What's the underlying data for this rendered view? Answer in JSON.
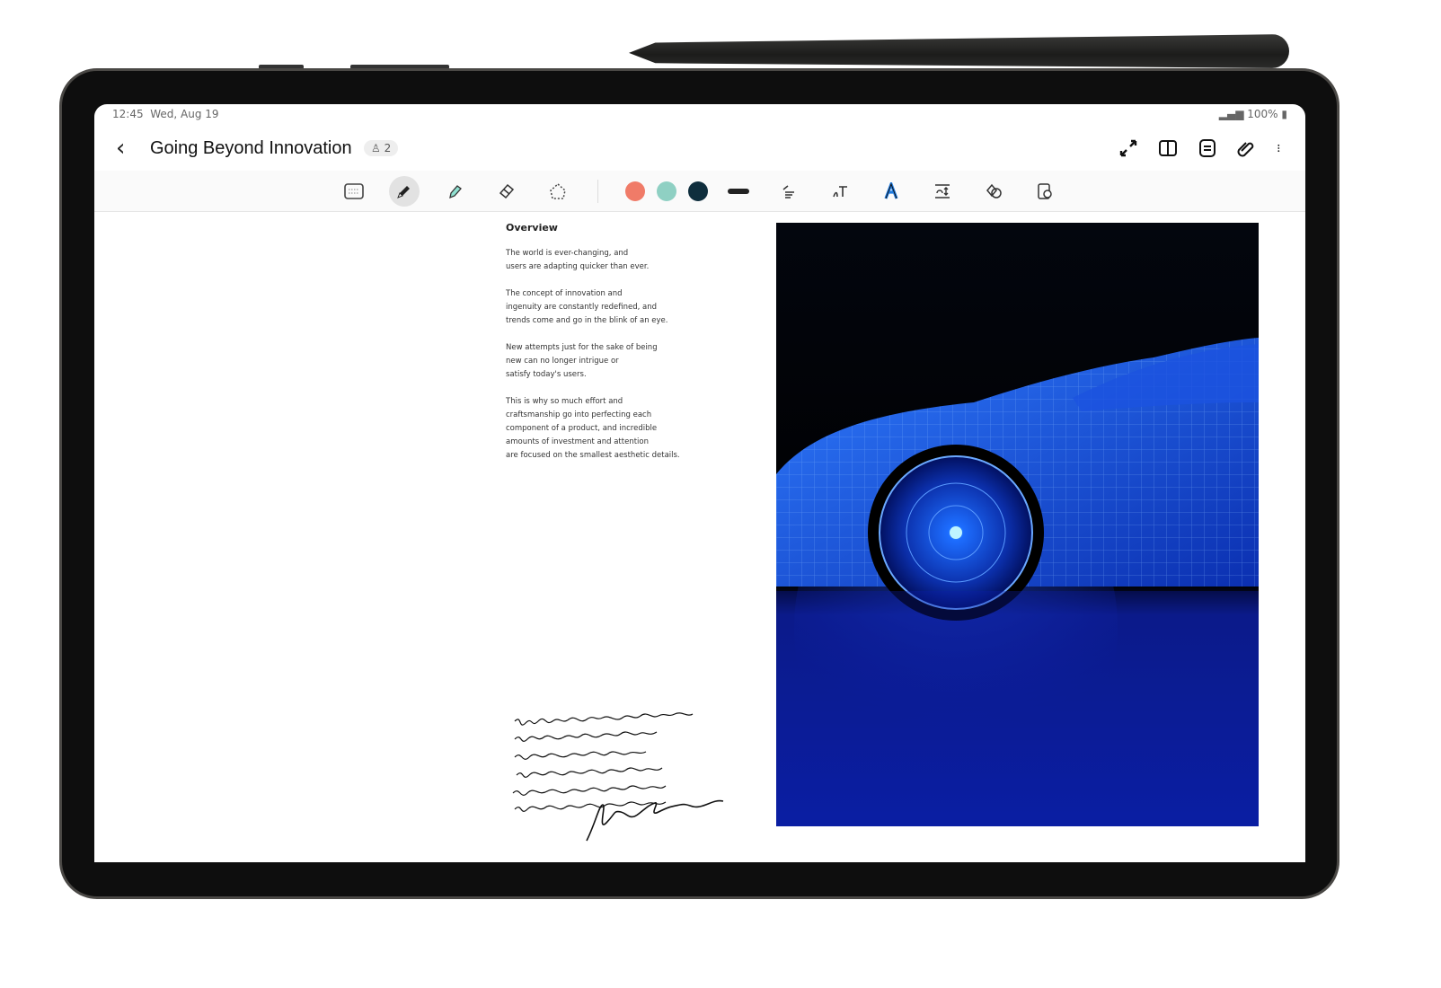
{
  "status": {
    "time": "12:45",
    "date": "Wed, Aug 19",
    "battery": "100%"
  },
  "header": {
    "title": "Going Beyond Innovation",
    "collaborators": "2"
  },
  "header_icons": [
    "fit-screen-icon",
    "book-view-icon",
    "page-view-icon",
    "attachment-icon",
    "more-icon"
  ],
  "toolbar": {
    "tools": [
      "keyboard-icon",
      "pen-icon",
      "highlighter-icon",
      "eraser-icon",
      "lasso-icon"
    ],
    "selected": "pen-icon",
    "colors": [
      "#f07b68",
      "#8fd0c3",
      "#0f2e3d"
    ],
    "tools2": [
      "stroke-width-icon",
      "text-align-icon",
      "handwriting-to-text-icon",
      "text-style-icon",
      "spacing-icon",
      "shapes-icon",
      "insert-icon"
    ]
  },
  "document": {
    "heading": "Overview",
    "paragraphs": [
      [
        "The world is ever-changing, and",
        "users are adapting quicker than ever."
      ],
      [
        "The concept of innovation and",
        "ingenuity are constantly redefined, and",
        "trends come and go in the blink of an eye."
      ],
      [
        "New attempts just for the sake of being",
        "new can no longer intrigue or",
        "satisfy today's users."
      ],
      [
        "This is why so much effort and",
        "craftsmanship go into perfecting each",
        "component of a product, and incredible",
        "amounts of investment and attention",
        "are focused on the smallest aesthetic details."
      ]
    ]
  }
}
